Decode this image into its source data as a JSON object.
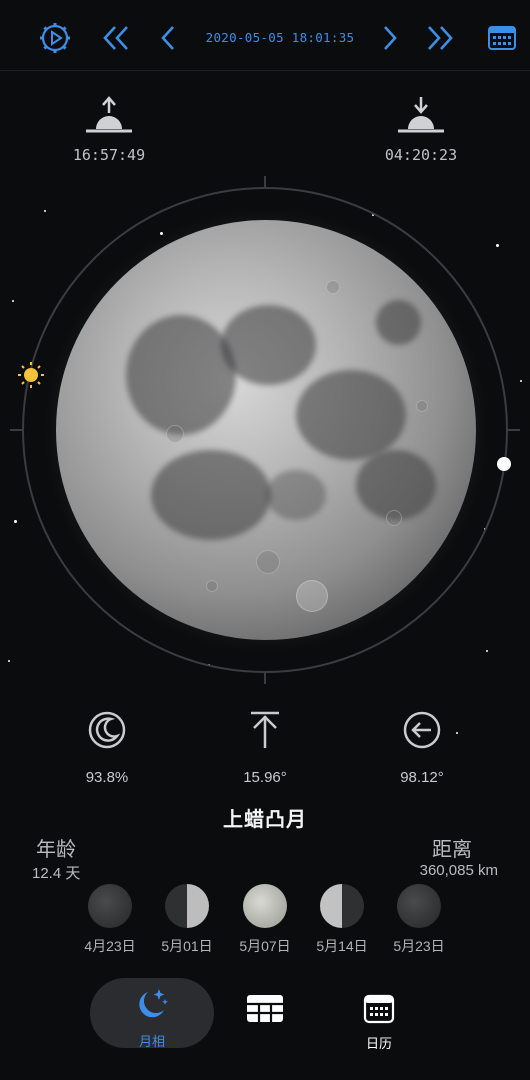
{
  "toolbar": {
    "datetime": "2020-05-05 18:01:35",
    "settings_icon": "gear-play-icon",
    "fast_back_icon": "double-chevron-left-icon",
    "back_icon": "chevron-left-icon",
    "forward_icon": "chevron-right-icon",
    "fast_forward_icon": "double-chevron-right-icon",
    "calendar_icon": "calendar-icon",
    "accent_color": "#3d8ee6"
  },
  "moonrise": {
    "time": "16:57:49",
    "icon": "moonrise-icon"
  },
  "moonset": {
    "time": "04:20:23",
    "icon": "moonset-icon"
  },
  "stats": {
    "illumination": {
      "value": "93.8%",
      "icon": "moon-phase-icon"
    },
    "altitude": {
      "value": "15.96°",
      "icon": "altitude-icon"
    },
    "azimuth": {
      "value": "98.12°",
      "icon": "azimuth-arrow-icon"
    }
  },
  "phase_name": "上蜡凸月",
  "age": {
    "label": "年龄",
    "value": "12.4 天"
  },
  "distance": {
    "label": "距离",
    "value": "360,085 km"
  },
  "phases": [
    {
      "date": "4月23日",
      "type": "new"
    },
    {
      "date": "5月01日",
      "type": "first-quarter"
    },
    {
      "date": "5月07日",
      "type": "full"
    },
    {
      "date": "5月14日",
      "type": "last-quarter"
    },
    {
      "date": "5月23日",
      "type": "new"
    }
  ],
  "tabs": [
    {
      "label": "月相",
      "icon": "moon-stars-icon",
      "active": true
    },
    {
      "label": "",
      "icon": "table-icon",
      "active": false
    },
    {
      "label": "日历",
      "icon": "calendar-grid-icon",
      "active": false
    }
  ]
}
